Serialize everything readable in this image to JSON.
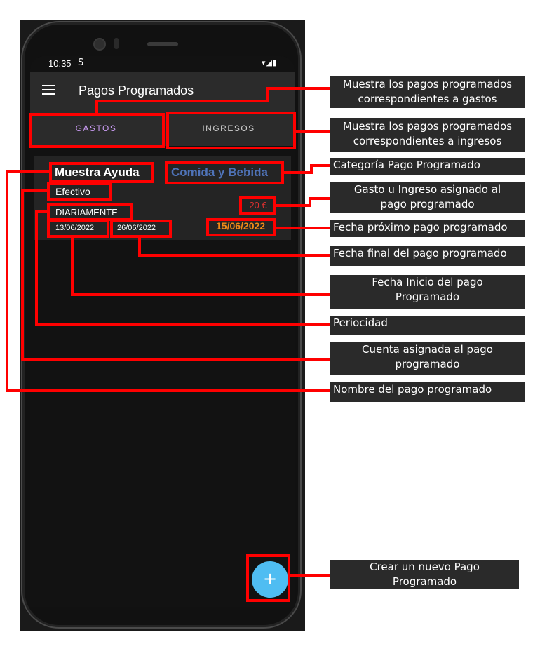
{
  "statusbar": {
    "time": "10:35",
    "sync_icon": "S",
    "icons": "▾◢▮"
  },
  "appbar": {
    "title": "Pagos Programados",
    "menu_icon": "hamburger-menu-icon"
  },
  "tabs": [
    {
      "label": "GASTOS",
      "selected": true
    },
    {
      "label": "INGRESOS",
      "selected": false
    }
  ],
  "card": {
    "name": "Muestra Ayuda",
    "category": "Comida y Bebida",
    "account": "Efectivo",
    "amount": "-20 €",
    "periodicity": "DIARIAMENTE",
    "start_date": "13/06/2022",
    "end_date": "26/06/2022",
    "next_date": "15/06/2022"
  },
  "fab": {
    "label": "+",
    "icon": "plus-icon"
  },
  "annotations": {
    "gastos": "Muestra los pagos programados\ncorrespondientes a gastos",
    "ingresos": "Muestra los pagos programados\ncorrespondientes a ingresos",
    "category": "Categoría Pago Programado",
    "amount": "Gasto u Ingreso asignado al\npago programado",
    "next_date": "Fecha próximo pago programado",
    "end_date": "Fecha final del pago programado",
    "start_date": "Fecha Inicio del pago\nProgramado",
    "periodicity": "Periocidad",
    "account": "Cuenta asignada al pago\nprogramado",
    "name": "Nombre del pago programado",
    "fab": "Crear un nuevo Pago\nProgramado"
  },
  "colors": {
    "accent": "#c99bf2",
    "category": "#4f73b8",
    "amount": "#e03030",
    "next_date": "#f08a18",
    "fab": "#4fbdf2",
    "highlight": "#ff0000"
  }
}
